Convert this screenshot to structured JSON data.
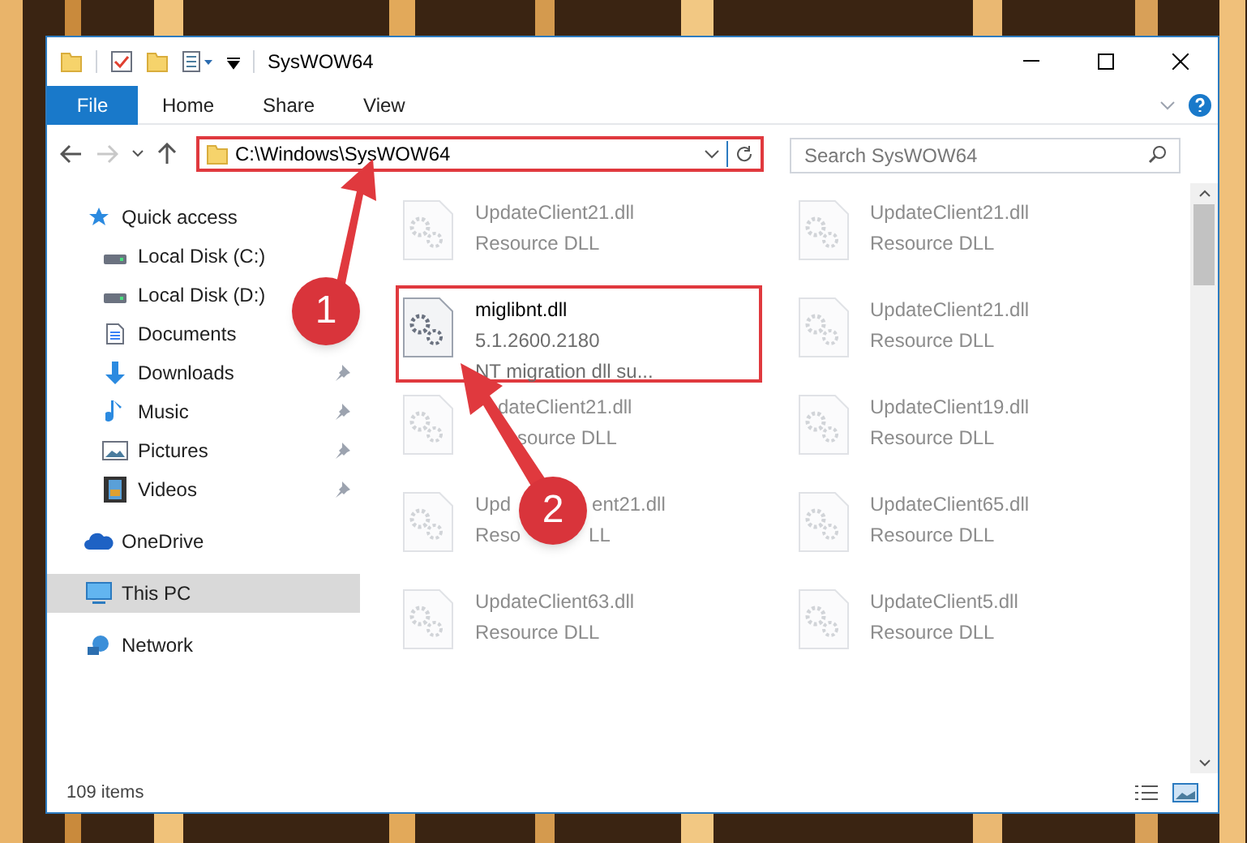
{
  "window": {
    "title": "SysWOW64"
  },
  "ribbon_tabs": [
    {
      "label": "File",
      "kind": "file"
    },
    {
      "label": "Home",
      "kind": "tab"
    },
    {
      "label": "Share",
      "kind": "tab"
    },
    {
      "label": "View",
      "kind": "tab"
    }
  ],
  "address": {
    "path": "C:\\Windows\\SysWOW64"
  },
  "search": {
    "placeholder": "Search SysWOW64"
  },
  "sidebar": {
    "items": [
      {
        "label": "Quick access",
        "selected": false,
        "children": [
          {
            "label": "Local Disk (C:)"
          },
          {
            "label": "Local Disk (D:)"
          },
          {
            "label": "Documents"
          },
          {
            "label": "Downloads",
            "pinned": true
          },
          {
            "label": "Music",
            "pinned": true
          },
          {
            "label": "Pictures",
            "pinned": true
          },
          {
            "label": "Videos",
            "pinned": true
          }
        ]
      },
      {
        "label": "OneDrive",
        "selected": false
      },
      {
        "label": "This PC",
        "selected": true
      },
      {
        "label": "Network",
        "selected": false
      }
    ]
  },
  "files": [
    {
      "kind": "faded",
      "name": "UpdateClient21.dll",
      "lines": [
        "Resource DLL"
      ]
    },
    {
      "kind": "faded",
      "name": "UpdateClient21.dll",
      "lines": [
        "Resource DLL"
      ]
    },
    {
      "kind": "file",
      "name": "miglibnt.dll",
      "lines": [
        "5.1.2600.2180",
        "NT migration dll su..."
      ]
    },
    {
      "kind": "faded",
      "name": "UpdateClient21.dll",
      "lines": [
        "Resource DLL"
      ]
    },
    {
      "kind": "covered",
      "name": "dateClient21.dll",
      "lines": [
        "source DLL"
      ]
    },
    {
      "kind": "faded",
      "name": "UpdateClient19.dll",
      "lines": [
        "Resource DLL"
      ]
    },
    {
      "kind": "split",
      "name_parts": [
        "Upd",
        "ent21.dll"
      ],
      "detail_parts": [
        "Reso",
        "LL"
      ]
    },
    {
      "kind": "faded",
      "name": "UpdateClient65.dll",
      "lines": [
        "Resource DLL"
      ]
    },
    {
      "kind": "faded",
      "name": "UpdateClient63.dll",
      "lines": [
        "Resource DLL"
      ]
    },
    {
      "kind": "faded",
      "name": "UpdateClient5.dll",
      "lines": [
        "Resource DLL"
      ]
    }
  ],
  "status_bar": {
    "count": "109 items"
  },
  "annotations": [
    {
      "label": "1"
    },
    {
      "label": "2"
    }
  ]
}
